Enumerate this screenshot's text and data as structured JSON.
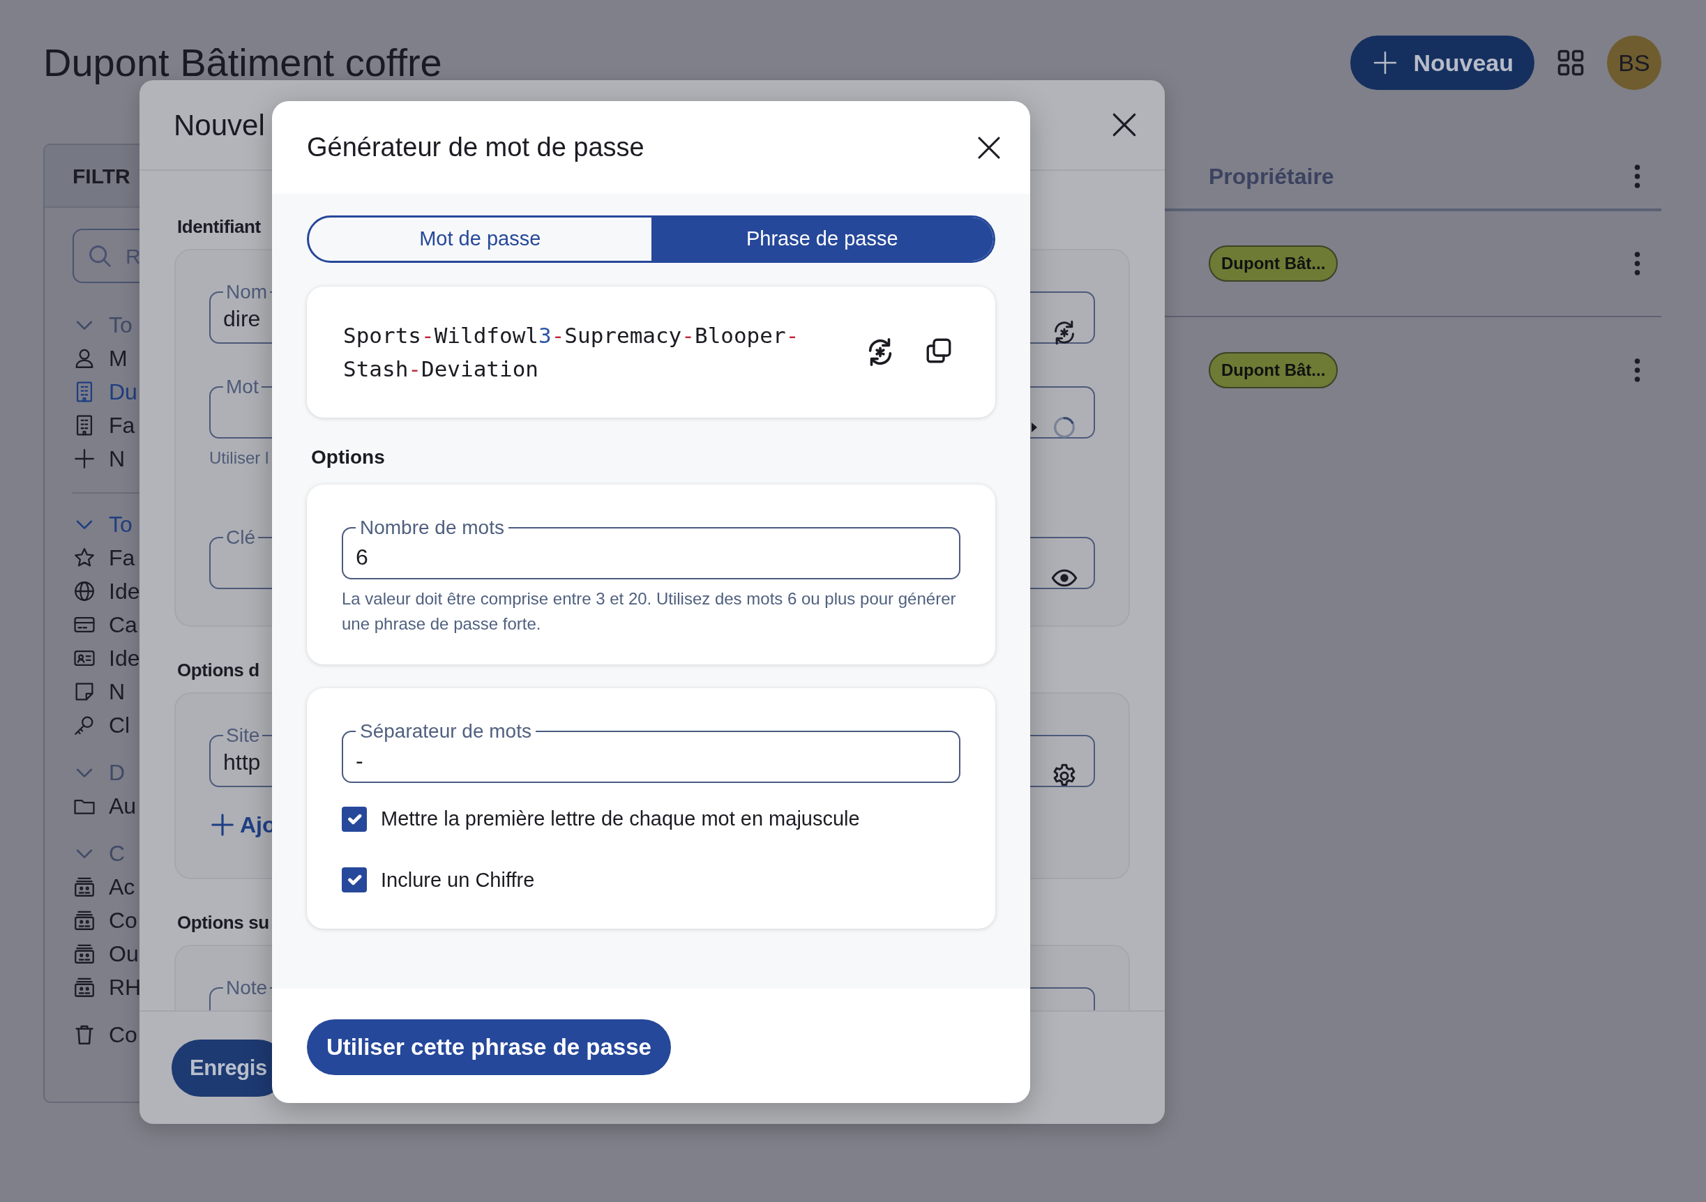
{
  "page": {
    "title": "Dupont Bâtiment coffre",
    "new_button": "Nouveau",
    "avatar": "BS"
  },
  "sidebar": {
    "heading": "FILTR",
    "search": {
      "placeholder": "R"
    },
    "groups": [
      {
        "label": "To",
        "expanded": true,
        "selected": false,
        "divider": false,
        "items": [
          {
            "kind": "user",
            "label": "M",
            "selected": false
          },
          {
            "kind": "org",
            "label": "Du",
            "selected": true
          },
          {
            "kind": "org",
            "label": "Fa",
            "selected": false
          },
          {
            "kind": "add",
            "label": "N",
            "selected": false
          }
        ]
      },
      {
        "label": "To",
        "expanded": true,
        "selected": true,
        "divider": true,
        "items": [
          {
            "kind": "favorite",
            "label": "Fa",
            "selected": false
          },
          {
            "kind": "login",
            "label": "Ide",
            "selected": false
          },
          {
            "kind": "card",
            "label": "Ca",
            "selected": false
          },
          {
            "kind": "identity",
            "label": "Ide",
            "selected": false
          },
          {
            "kind": "note",
            "label": "N",
            "selected": false
          },
          {
            "kind": "key",
            "label": "Cl",
            "selected": false
          }
        ]
      },
      {
        "label": "D",
        "expanded": true,
        "selected": false,
        "divider": false,
        "items": [
          {
            "kind": "folder",
            "label": "Au",
            "selected": false
          }
        ]
      },
      {
        "label": "C",
        "expanded": true,
        "selected": false,
        "divider": false,
        "items": [
          {
            "kind": "collection",
            "label": "Ac",
            "selected": false
          },
          {
            "kind": "collection",
            "label": "Co",
            "selected": false
          },
          {
            "kind": "collection",
            "label": "Ou",
            "selected": false
          },
          {
            "kind": "collection",
            "label": "RH",
            "selected": false
          }
        ]
      }
    ],
    "trash_item": {
      "label": "Co"
    }
  },
  "table": {
    "columns": [
      {
        "label": "Propriétaire"
      }
    ],
    "rows": [
      {
        "owner": "Dupont Bât..."
      },
      {
        "owner": "Dupont Bât..."
      }
    ]
  },
  "item_dialog": {
    "title": "Nouvel",
    "sections": [
      {
        "heading": "Identifiant",
        "fields": [
          {
            "label": "Nom",
            "value": "dire",
            "kind": "regenerate"
          },
          {
            "label": "Mot",
            "kind": "password",
            "help": "Utiliser l"
          },
          {
            "label": "Clé",
            "kind": "visibility"
          }
        ]
      },
      {
        "heading": "Options d",
        "fields": [
          {
            "label": "Site",
            "value": "http",
            "kind": "settings"
          }
        ],
        "add_link": "Ajo"
      },
      {
        "heading": "Options su",
        "fields": [
          {
            "label": "Note",
            "kind": "text"
          }
        ]
      }
    ],
    "save_button": "Enregis"
  },
  "generator": {
    "title": "Générateur de mot de passe",
    "tabs": [
      {
        "label": "Mot de passe",
        "selected": false
      },
      {
        "label": "Phrase de passe",
        "selected": true
      }
    ],
    "passphrase": [
      {
        "kind": "word",
        "text": "Sports"
      },
      {
        "kind": "separator",
        "text": "-"
      },
      {
        "kind": "word",
        "text": "Wildfowl"
      },
      {
        "kind": "digit",
        "text": "3"
      },
      {
        "kind": "separator",
        "text": "-"
      },
      {
        "kind": "word",
        "text": "Supremacy"
      },
      {
        "kind": "separator",
        "text": "-"
      },
      {
        "kind": "word",
        "text": "Blooper"
      },
      {
        "kind": "separator",
        "text": "-"
      },
      {
        "kind": "word",
        "text": "Stash"
      },
      {
        "kind": "separator",
        "text": "-"
      },
      {
        "kind": "word",
        "text": "Deviation"
      }
    ],
    "options_heading": "Options",
    "word_count": {
      "label": "Nombre de mots",
      "value": "6",
      "help": "La valeur doit être comprise entre 3 et 20. Utilisez des mots 6 ou plus pour générer une phrase de passe forte."
    },
    "separator": {
      "label": "Séparateur de mots",
      "value": "-"
    },
    "checkboxes": [
      {
        "label": "Mettre la première lettre de chaque mot en majuscule",
        "checked": true
      },
      {
        "label": "Inclure un Chiffre",
        "checked": true
      }
    ],
    "use_button": "Utiliser cette phrase de passe"
  }
}
